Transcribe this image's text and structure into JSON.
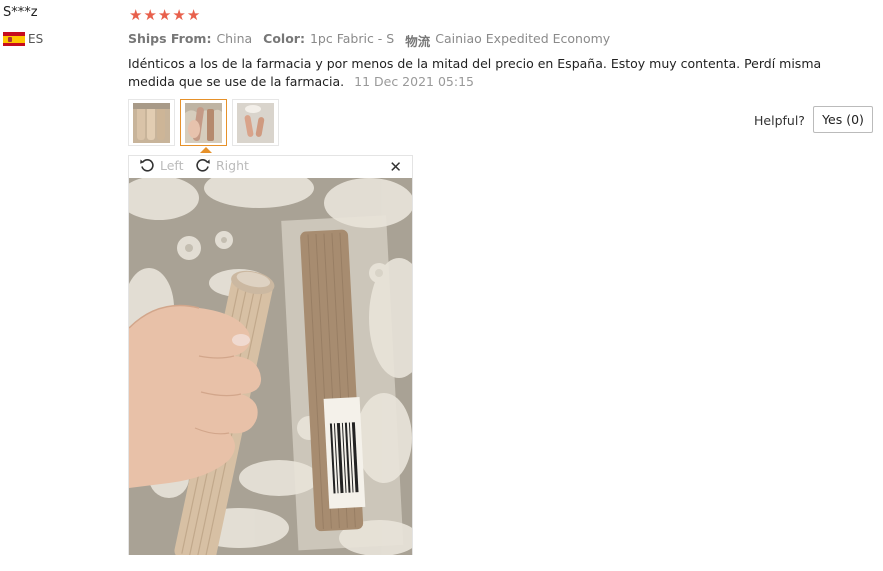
{
  "reviewer": {
    "name": "S***z",
    "country_code": "ES",
    "flag_icon": "spain-flag-icon"
  },
  "rating": {
    "stars": 5,
    "max": 5,
    "color": "#e8604c"
  },
  "meta": {
    "ships_from_label": "Ships From:",
    "ships_from_value": "China",
    "color_label": "Color:",
    "color_value": "1pc Fabric - S",
    "logistics_label": "物流",
    "logistics_value": "Cainiao Expedited Economy"
  },
  "review": {
    "text": "Idénticos a los de la farmacia y por menos de la mitad del precio en España. Estoy muy contenta. Perdí misma medida que se use de la farmacia.",
    "date": "11 Dec 2021 05:15"
  },
  "feedback": {
    "helpful_label": "Helpful?",
    "yes_button": "Yes (0)"
  },
  "viewer": {
    "rotate_left": "Left",
    "rotate_right": "Right",
    "close_icon": "close-icon",
    "active_thumbnail": 2
  },
  "colors": {
    "accent": "#e6912a",
    "star": "#e8604c"
  }
}
